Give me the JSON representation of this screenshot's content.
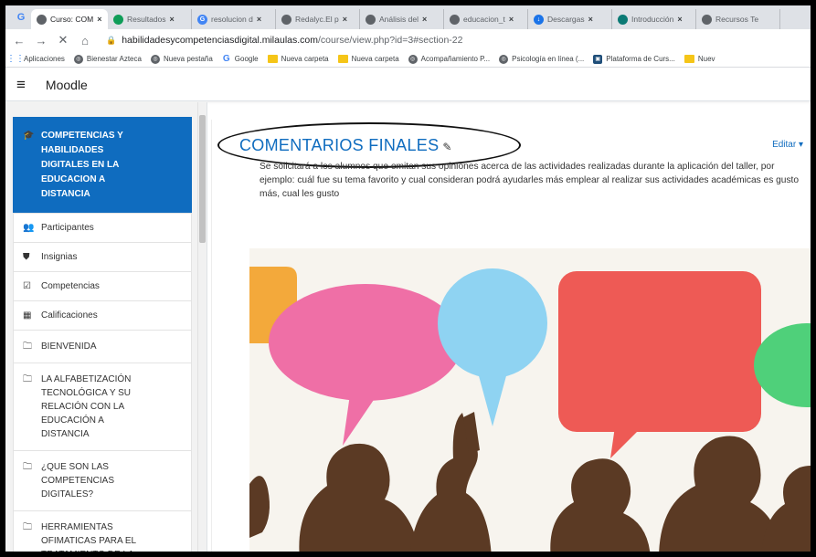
{
  "browser": {
    "tabs": [
      {
        "title": "Curso: COM",
        "active": true,
        "icon": "globe-icon",
        "color": "#5f6368"
      },
      {
        "title": "Resultados",
        "active": false,
        "icon": "drive-icon",
        "color": "#0f9d58"
      },
      {
        "title": "resolucion d",
        "active": false,
        "icon": "google-icon",
        "color": "#4285f4"
      },
      {
        "title": "Redalyc.El p",
        "active": false,
        "icon": "globe-icon",
        "color": "#5f6368"
      },
      {
        "title": "Análisis del",
        "active": false,
        "icon": "globe-icon",
        "color": "#5f6368"
      },
      {
        "title": "educacion_t",
        "active": false,
        "icon": "globe-icon",
        "color": "#5f6368"
      },
      {
        "title": "Descargas",
        "active": false,
        "icon": "download-icon",
        "color": "#1a73e8"
      },
      {
        "title": "Introducción",
        "active": false,
        "icon": "page-icon",
        "color": "#0b7a75"
      },
      {
        "title": "Recursos Te",
        "active": false,
        "icon": "globe-icon",
        "color": "#5f6368"
      }
    ],
    "url_domain": "habilidadesycompetenciasdigital.milaulas.com",
    "url_path": "/course/view.php?id=3#section-22",
    "bookmarks": [
      {
        "label": "Aplicaciones",
        "icon": "apps-icon"
      },
      {
        "label": "Bienestar Azteca",
        "icon": "globe-icon"
      },
      {
        "label": "Nueva pestaña",
        "icon": "globe-icon"
      },
      {
        "label": "Google",
        "icon": "google-icon"
      },
      {
        "label": "Nueva carpeta",
        "icon": "folder-icon"
      },
      {
        "label": "Nueva carpeta",
        "icon": "folder-icon"
      },
      {
        "label": "Acompañamiento P...",
        "icon": "globe-icon"
      },
      {
        "label": "Psicología en línea (...",
        "icon": "globe-icon"
      },
      {
        "label": "Plataforma de Curs...",
        "icon": "platform-icon"
      },
      {
        "label": "Nuev",
        "icon": "folder-icon"
      }
    ]
  },
  "moodle": {
    "site_name": "Moodle",
    "drawer": [
      {
        "label": "COMPETENCIAS Y\nHABILIDADES\nDIGITALES EN LA\nEDUCACION A\nDISTANCIA",
        "icon": "graduation-cap-icon",
        "glyph": "🎓",
        "active": true,
        "kind": "course"
      },
      {
        "label": "Participantes",
        "icon": "users-icon",
        "glyph": "👥",
        "active": false,
        "kind": "link"
      },
      {
        "label": "Insignias",
        "icon": "shield-icon",
        "glyph": "⛊",
        "active": false,
        "kind": "link"
      },
      {
        "label": "Competencias",
        "icon": "check-square-icon",
        "glyph": "☑",
        "active": false,
        "kind": "link"
      },
      {
        "label": "Calificaciones",
        "icon": "table-icon",
        "glyph": "▦",
        "active": false,
        "kind": "link"
      },
      {
        "label": "BIENVENIDA",
        "icon": "folder-icon",
        "glyph": "🗀",
        "active": false,
        "kind": "section"
      },
      {
        "label": "LA ALFABETIZACIÓN\nTECNOLÓGICA Y SU\nRELACIÓN CON LA\nEDUCACIÓN A\nDISTANCIA",
        "icon": "folder-icon",
        "glyph": "🗀",
        "active": false,
        "kind": "section"
      },
      {
        "label": "¿QUE SON LAS\nCOMPETENCIAS\nDIGITALES?",
        "icon": "folder-icon",
        "glyph": "🗀",
        "active": false,
        "kind": "section"
      },
      {
        "label": "HERRAMIENTAS\nOFIMATICAS PARA EL\nTRATAMIENTO DE LA\nINFORMACION",
        "icon": "folder-icon",
        "glyph": "🗀",
        "active": false,
        "kind": "section"
      }
    ],
    "section_title": "COMENTARIOS FINALES",
    "edit_menu": "Editar ▾",
    "summary": "Se solicitará a los alumnos que emitan sus opiniones acerca de las actividades realizadas durante la aplicación del taller, por ejemplo: cuál fue su tema favorito y cual consideran podrá ayudarles más emplear al realizar sus actividades académicas es gusto más, cual les gusto",
    "colors": {
      "accent": "#0f6cbf",
      "bubble_pink": "#ef6fa6",
      "bubble_blue": "#8fd3f2",
      "bubble_red": "#ee5a55",
      "bubble_green": "#4fd07a",
      "bubble_orange": "#f3a93b",
      "silhouette": "#5b3a24"
    }
  }
}
